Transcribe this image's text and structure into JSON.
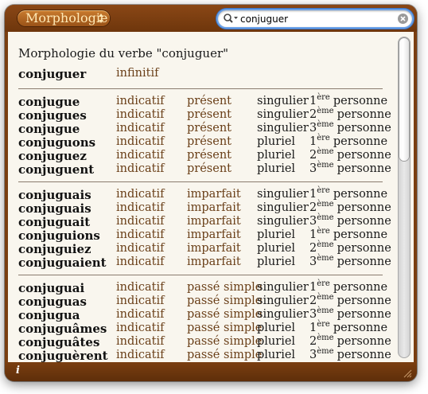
{
  "toolbar": {
    "dictionary_label": "Morphologie",
    "search_value": "conjuguer"
  },
  "content": {
    "heading": "Morphologie du verbe \"conjuguer\"",
    "infinitive": {
      "form": "conjuguer",
      "mood": "infinitif"
    },
    "groups": [
      {
        "rows": [
          {
            "form": "conjugue",
            "mood": "indicatif",
            "tense": "présent",
            "number": "singulier",
            "person_num": "1",
            "person_sup": "ère",
            "person_word": "personne"
          },
          {
            "form": "conjugues",
            "mood": "indicatif",
            "tense": "présent",
            "number": "singulier",
            "person_num": "2",
            "person_sup": "ème",
            "person_word": "personne"
          },
          {
            "form": "conjugue",
            "mood": "indicatif",
            "tense": "présent",
            "number": "singulier",
            "person_num": "3",
            "person_sup": "ème",
            "person_word": "personne"
          },
          {
            "form": "conjuguons",
            "mood": "indicatif",
            "tense": "présent",
            "number": "pluriel",
            "person_num": "1",
            "person_sup": "ère",
            "person_word": "personne"
          },
          {
            "form": "conjuguez",
            "mood": "indicatif",
            "tense": "présent",
            "number": "pluriel",
            "person_num": "2",
            "person_sup": "ème",
            "person_word": "personne"
          },
          {
            "form": "conjuguent",
            "mood": "indicatif",
            "tense": "présent",
            "number": "pluriel",
            "person_num": "3",
            "person_sup": "ème",
            "person_word": "personne"
          }
        ]
      },
      {
        "rows": [
          {
            "form": "conjuguais",
            "mood": "indicatif",
            "tense": "imparfait",
            "number": "singulier",
            "person_num": "1",
            "person_sup": "ère",
            "person_word": "personne"
          },
          {
            "form": "conjuguais",
            "mood": "indicatif",
            "tense": "imparfait",
            "number": "singulier",
            "person_num": "2",
            "person_sup": "ème",
            "person_word": "personne"
          },
          {
            "form": "conjuguait",
            "mood": "indicatif",
            "tense": "imparfait",
            "number": "singulier",
            "person_num": "3",
            "person_sup": "ème",
            "person_word": "personne"
          },
          {
            "form": "conjuguions",
            "mood": "indicatif",
            "tense": "imparfait",
            "number": "pluriel",
            "person_num": "1",
            "person_sup": "ère",
            "person_word": "personne"
          },
          {
            "form": "conjuguiez",
            "mood": "indicatif",
            "tense": "imparfait",
            "number": "pluriel",
            "person_num": "2",
            "person_sup": "ème",
            "person_word": "personne"
          },
          {
            "form": "conjuguaient",
            "mood": "indicatif",
            "tense": "imparfait",
            "number": "pluriel",
            "person_num": "3",
            "person_sup": "ème",
            "person_word": "personne"
          }
        ]
      },
      {
        "rows": [
          {
            "form": "conjuguai",
            "mood": "indicatif",
            "tense": "passé simple",
            "number": "singulier",
            "person_num": "1",
            "person_sup": "ère",
            "person_word": "personne"
          },
          {
            "form": "conjuguas",
            "mood": "indicatif",
            "tense": "passé simple",
            "number": "singulier",
            "person_num": "2",
            "person_sup": "ème",
            "person_word": "personne"
          },
          {
            "form": "conjugua",
            "mood": "indicatif",
            "tense": "passé simple",
            "number": "singulier",
            "person_num": "3",
            "person_sup": "ème",
            "person_word": "personne"
          },
          {
            "form": "conjuguâmes",
            "mood": "indicatif",
            "tense": "passé simple",
            "number": "pluriel",
            "person_num": "1",
            "person_sup": "ère",
            "person_word": "personne"
          },
          {
            "form": "conjuguâtes",
            "mood": "indicatif",
            "tense": "passé simple",
            "number": "pluriel",
            "person_num": "2",
            "person_sup": "ème",
            "person_word": "personne"
          },
          {
            "form": "conjuguèrent",
            "mood": "indicatif",
            "tense": "passé simple",
            "number": "pluriel",
            "person_num": "3",
            "person_sup": "ème",
            "person_word": "personne"
          }
        ]
      }
    ]
  },
  "bottombar": {
    "info_label": "i"
  },
  "colors": {
    "window_brown": "#7a3e10",
    "content_bg": "#f9f6ee",
    "annotation_brown": "#6a3f18",
    "search_focus": "#3b74c4"
  },
  "icons": {
    "search": "magnifier-icon",
    "clear": "clear-search-icon",
    "dictionary_menu": "popup-arrows-icon",
    "info": "info-icon",
    "resize": "resize-grip-icon"
  }
}
